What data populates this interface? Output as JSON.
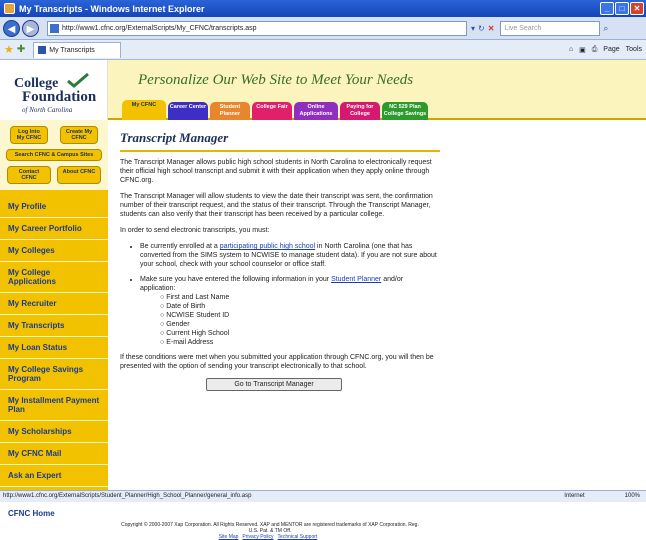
{
  "window": {
    "title": "My Transcripts - Windows Internet Explorer"
  },
  "browser": {
    "url": "http://www1.cfnc.org/ExternalScripts/My_CFNC/transcripts.asp",
    "search_placeholder": "Live Search",
    "tab_label": "My Transcripts",
    "page_menu": "Page",
    "tools_menu": "Tools"
  },
  "logo": {
    "line1": "College",
    "line2": "Foundation",
    "line3": "of North Carolina"
  },
  "banner": {
    "slogan": "Personalize Our Web Site to Meet Your Needs",
    "tabs": [
      {
        "label": "My CFNC",
        "color": "#f2c200"
      },
      {
        "label": "Career Center",
        "color": "#3d2fc4"
      },
      {
        "label": "Student Planner",
        "color": "#e8862e"
      },
      {
        "label": "College Fair",
        "color": "#e0206a"
      },
      {
        "label": "Online Applications",
        "color": "#8e2fc0"
      },
      {
        "label": "Paying for College",
        "color": "#d6186e"
      },
      {
        "label": "NC 529 Plan College Savings",
        "color": "#2e9a2e"
      }
    ]
  },
  "sidebar": {
    "login": "Log Into My CFNC",
    "create": "Create My CFNC",
    "search": "Search CFNC & Campus Sites",
    "contact": "Contact CFNC",
    "about": "About CFNC",
    "items": [
      "My Profile",
      "My Career Portfolio",
      "My Colleges",
      "My College Applications",
      "My Recruiter",
      "My Transcripts",
      "My Loan Status",
      "My College Savings Program",
      "My Installment Payment Plan",
      "My Scholarships",
      "My CFNC Mail",
      "Ask an Expert"
    ],
    "home": "CFNC Home"
  },
  "content": {
    "title": "Transcript Manager",
    "p1": "The Transcript Manager allows public high school students in North Carolina to electronically request their official high school transcript and submit it with their application when they apply online through CFNC.org.",
    "p2": "The Transcript Manager will allow students to view the date their transcript was sent, the confirmation number of their transcript request, and the status of their transcript. Through the Transcript Manager, students can also verify that their transcript has been received by a particular college.",
    "p3": "In order to send electronic transcripts, you must:",
    "b1_pre": "Be currently enrolled at a ",
    "b1_link": "participating public high school",
    "b1_post": " in North Carolina (one that has converted from the SIMS system to NCWISE to manage student data). If you are not sure about your school, check with your school counselor or office staff.",
    "b2_pre": "Make sure you have entered the following information in your ",
    "b2_link": "Student Planner",
    "b2_post": " and/or application:",
    "fields": [
      "First and Last Name",
      "Date of Birth",
      "NCWISE Student ID",
      "Gender",
      "Current High School",
      "E-mail Address"
    ],
    "p4": "If these conditions were met when you submitted your application through CFNC.org, you will then be presented with the option of sending your transcript electronically to that school.",
    "button": "Go to Transcript Manager",
    "copyright": "Copyright © 2000-2007 Xap Corporation. All Rights Reserved. XAP and MENTOR are registered trademarks of XAP Corporation. Reg. U.S. Pat. & TM Off.",
    "links": [
      "Site Map",
      "Privacy Policy",
      "Technical Support"
    ]
  },
  "status": {
    "text": "http://www1.cfnc.org/ExternalScripts/Student_Planner/High_School_Planner/general_info.asp",
    "zone": "Internet",
    "zoom": "100%"
  }
}
